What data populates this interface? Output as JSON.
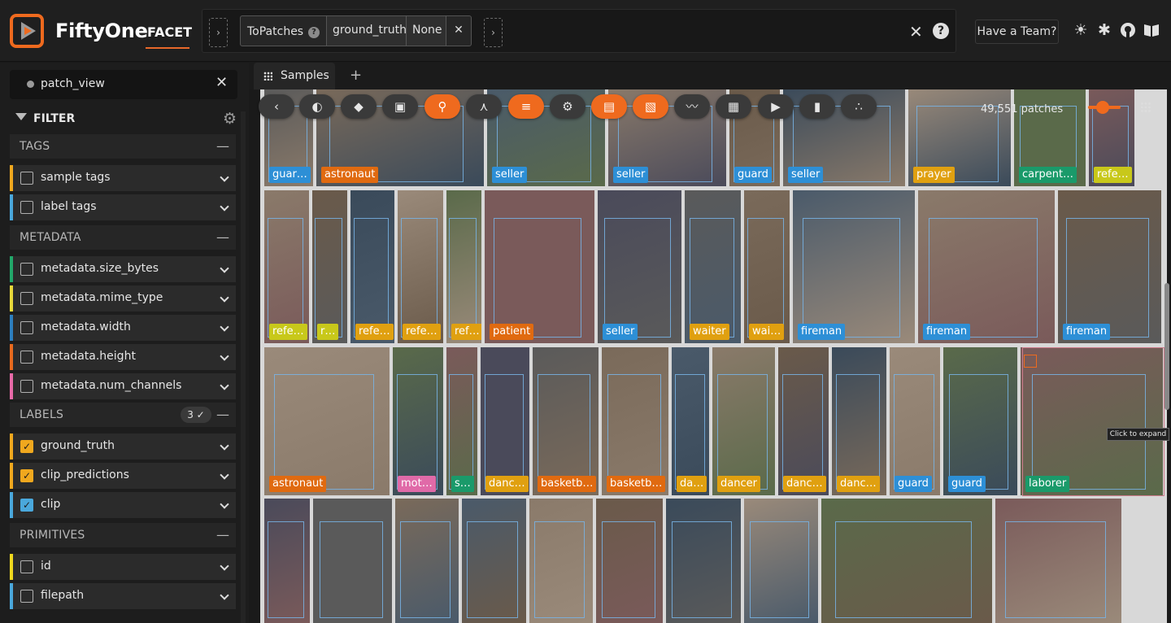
{
  "app": {
    "brand": "FiftyOne",
    "nav_tab": "FACET",
    "accent_color": "#ef6a1e"
  },
  "view_bar": {
    "stage_name": "ToPatches",
    "params": [
      "ground_truth",
      "None"
    ],
    "close_glyph": "✕"
  },
  "header": {
    "team_button": "Have a Team?",
    "icons": [
      "sun-icon",
      "slack-icon",
      "github-icon",
      "docs-icon"
    ]
  },
  "sidebar": {
    "current_view": "patch_view",
    "filter_label": "FILTER",
    "sections": {
      "tags": "TAGS",
      "metadata": "METADATA",
      "labels": "LABELS",
      "labels_count": "3 ✓",
      "primitives": "PRIMITIVES"
    },
    "fields": [
      {
        "name": "sample tags",
        "checked": false,
        "color": "#f0a81e"
      },
      {
        "name": "label tags",
        "checked": false,
        "color": "#4aa8dc"
      },
      {
        "name": "metadata.size_bytes",
        "checked": false,
        "color": "#22a86a"
      },
      {
        "name": "metadata.mime_type",
        "checked": false,
        "color": "#e8d83a"
      },
      {
        "name": "metadata.width",
        "checked": false,
        "color": "#2d7fbf"
      },
      {
        "name": "metadata.height",
        "checked": false,
        "color": "#e86a1e"
      },
      {
        "name": "metadata.num_channels",
        "checked": false,
        "color": "#e86aa8"
      },
      {
        "name": "ground_truth",
        "checked": true,
        "color": "#f0a81e"
      },
      {
        "name": "clip_predictions",
        "checked": true,
        "color": "#f0a81e"
      },
      {
        "name": "clip",
        "checked": true,
        "color": "#4aa8dc"
      },
      {
        "name": "id",
        "checked": false,
        "color": "#f0d81e"
      },
      {
        "name": "filepath",
        "checked": false,
        "color": "#4aa8dc"
      }
    ]
  },
  "tabs": {
    "samples": "Samples",
    "add": "+"
  },
  "grid": {
    "patch_count": "49,551 patches",
    "tooltip": "Click to expand",
    "tiles": [
      {
        "label": "guar…",
        "color": "#2d8fd6"
      },
      {
        "label": "astronaut",
        "color": "#e06a10"
      },
      {
        "label": "seller",
        "color": "#2d8fd6"
      },
      {
        "label": "seller",
        "color": "#2d8fd6"
      },
      {
        "label": "guard",
        "color": "#2d8fd6"
      },
      {
        "label": "seller",
        "color": "#2d8fd6"
      },
      {
        "label": "prayer",
        "color": "#e0a010"
      },
      {
        "label": "carpent…",
        "color": "#1a9a6a"
      },
      {
        "label": "refe…",
        "color": "#c8c81a"
      },
      {
        "label": "refe…",
        "color": "#c8c81a"
      },
      {
        "label": "r…",
        "color": "#c8c81a"
      },
      {
        "label": "refe…",
        "color": "#e0a010"
      },
      {
        "label": "refe…",
        "color": "#e0a010"
      },
      {
        "label": "ref…",
        "color": "#e0a010"
      },
      {
        "label": "patient",
        "color": "#e06a10"
      },
      {
        "label": "seller",
        "color": "#2d8fd6"
      },
      {
        "label": "waiter",
        "color": "#e0a010"
      },
      {
        "label": "wai…",
        "color": "#e0a010"
      },
      {
        "label": "fireman",
        "color": "#2d8fd6"
      },
      {
        "label": "fireman",
        "color": "#2d8fd6"
      },
      {
        "label": "fireman",
        "color": "#2d8fd6"
      },
      {
        "label": "astronaut",
        "color": "#e06a10"
      },
      {
        "label": "mot…",
        "color": "#e06aa8"
      },
      {
        "label": "s…",
        "color": "#1a9a6a"
      },
      {
        "label": "danc…",
        "color": "#e0a010"
      },
      {
        "label": "basketb…",
        "color": "#e06a10"
      },
      {
        "label": "basketb…",
        "color": "#e06a10"
      },
      {
        "label": "da…",
        "color": "#e0a010"
      },
      {
        "label": "dancer",
        "color": "#e0a010"
      },
      {
        "label": "danc…",
        "color": "#e0a010"
      },
      {
        "label": "danc…",
        "color": "#e0a010"
      },
      {
        "label": "guard",
        "color": "#2d8fd6"
      },
      {
        "label": "guard",
        "color": "#2d8fd6"
      },
      {
        "label": "laborer",
        "color": "#1a9a6a"
      }
    ]
  }
}
